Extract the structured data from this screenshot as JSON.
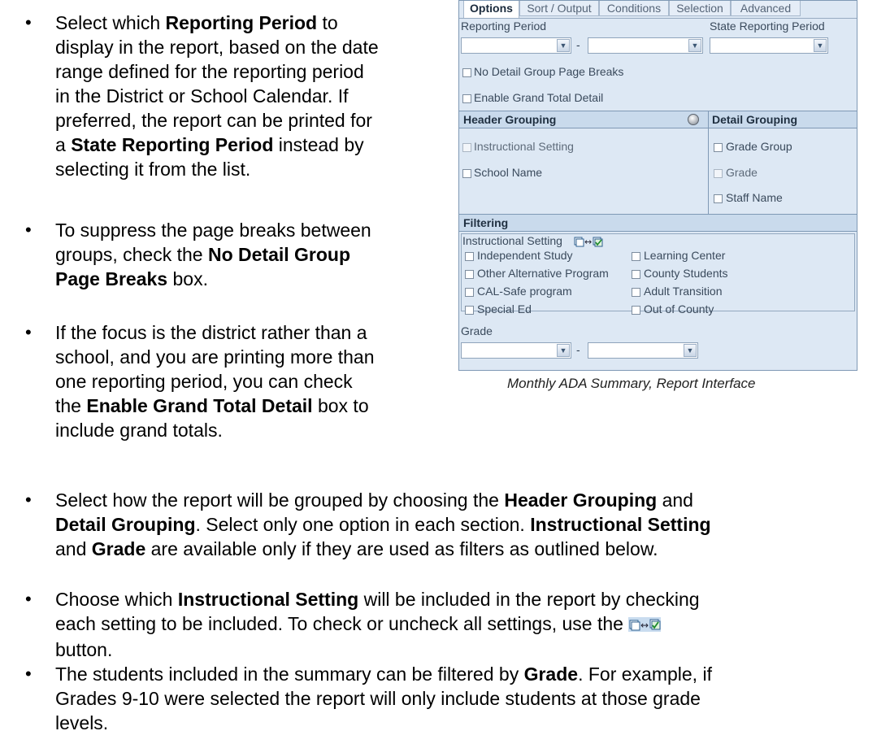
{
  "bullets_top": [
    {
      "lines": [
        [
          "Select which ",
          {
            "b": "Reporting Period"
          },
          " to"
        ],
        [
          "display in the report, based on the date"
        ],
        [
          "range defined for the reporting period"
        ],
        [
          "in the District or School Calendar. If"
        ],
        [
          "preferred, the report can be printed for"
        ],
        [
          "a ",
          {
            "b": "State Reporting Period"
          },
          " instead by"
        ],
        [
          "selecting it from the list."
        ]
      ]
    },
    {
      "lines": [
        [
          "To suppress the page breaks between"
        ],
        [
          "groups, check the ",
          {
            "b": "No Detail Group"
          }
        ],
        [
          {
            "b": "Page Breaks"
          },
          " box."
        ]
      ]
    },
    {
      "lines": [
        [
          "If the focus is the district rather than a"
        ],
        [
          "school, and you are printing more than"
        ],
        [
          "one reporting period, you can check"
        ],
        [
          "the ",
          {
            "b": "Enable Grand Total Detail"
          },
          " box to"
        ],
        [
          "include grand totals."
        ]
      ]
    }
  ],
  "bullets_bottom": [
    {
      "lines": [
        [
          "Select how the report will be grouped by choosing the ",
          {
            "b": "Header Grouping"
          },
          " and"
        ],
        [
          {
            "b": "Detail Grouping"
          },
          ". Select only one option in each section. ",
          {
            "b": "Instructional Setting"
          }
        ],
        [
          "and ",
          {
            "b": "Grade"
          },
          " are available only if they are used as filters as outlined below."
        ]
      ]
    },
    {
      "lines": [
        [
          "Choose which ",
          {
            "b": "Instructional Setting"
          },
          " will be included in the report by checking"
        ],
        [
          "each setting to be included. To check or uncheck all settings, use the ",
          {
            "icon": "toggle"
          }
        ],
        [
          "button."
        ]
      ]
    },
    {
      "lines": [
        [
          "The students included in the summary can be filtered by ",
          {
            "b": "Grade"
          },
          ". For example, if"
        ],
        [
          "Grades 9-10 were selected the report will only include students at those grade"
        ],
        [
          "levels."
        ]
      ]
    }
  ],
  "panel": {
    "tabs": [
      "Options",
      "Sort / Output",
      "Conditions",
      "Selection",
      "Advanced"
    ],
    "active_tab": "Options",
    "reporting_period_label": "Reporting Period",
    "state_reporting_period_label": "State Reporting Period",
    "range_dash": "-",
    "no_detail_group_page_breaks": "No Detail Group Page Breaks",
    "enable_grand_total_detail": "Enable Grand Total Detail",
    "header_grouping": {
      "title": "Header Grouping",
      "items": [
        "Instructional Setting",
        "School Name"
      ]
    },
    "detail_grouping": {
      "title": "Detail Grouping",
      "items": [
        "Grade Group",
        "Grade",
        "Staff Name"
      ]
    },
    "filtering": {
      "title": "Filtering",
      "instructional_setting_label": "Instructional Setting",
      "left_options": [
        "Independent Study",
        "Other Alternative Program",
        "CAL-Safe program",
        "Special Ed"
      ],
      "right_options": [
        "Learning Center",
        "County Students",
        "Adult Transition",
        "Out of County"
      ],
      "grade_label": "Grade",
      "grade_dash": "-"
    }
  },
  "caption": "Monthly ADA Summary, Report Interface",
  "colors": {
    "panel_bg": "#dde8f4",
    "section_head": "#c9daec",
    "border": "#7f99b5",
    "toggle_icon": "#2e86c9"
  }
}
